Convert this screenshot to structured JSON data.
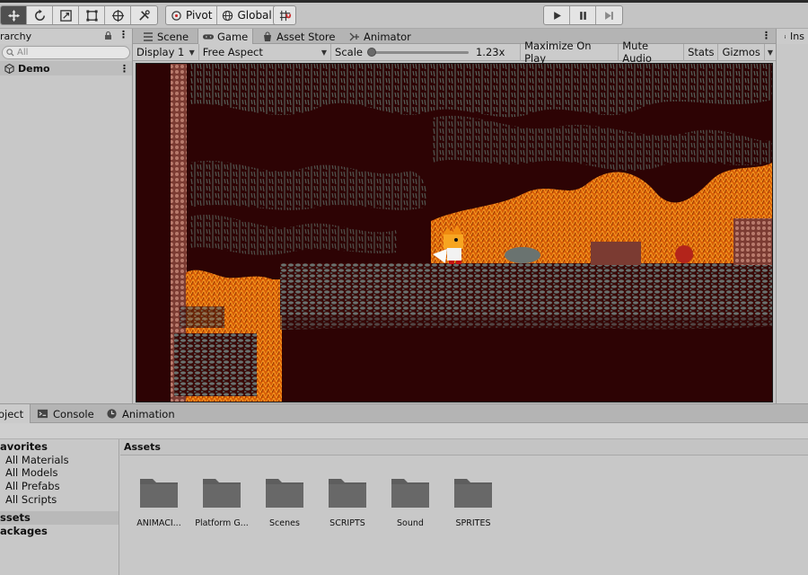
{
  "toolbar": {
    "pivot_label": "Pivot",
    "global_label": "Global"
  },
  "hierarchy": {
    "tab_label": "rarchy",
    "search_placeholder": "All",
    "scene_name": "Demo"
  },
  "game_view": {
    "tabs": [
      {
        "label": "Scene"
      },
      {
        "label": "Game"
      },
      {
        "label": "Asset Store"
      },
      {
        "label": "Animator"
      }
    ],
    "display": "Display 1",
    "aspect": "Free Aspect",
    "scale_label": "Scale",
    "scale_value": "1.23x",
    "maximize_on_play": "Maximize On Play",
    "mute_audio": "Mute Audio",
    "stats": "Stats",
    "gizmos": "Gizmos"
  },
  "inspector": {
    "tab_label": "Ins"
  },
  "project": {
    "tabs": [
      {
        "label": "oject"
      },
      {
        "label": "Console"
      },
      {
        "label": "Animation"
      }
    ],
    "favorites_label": "avorites",
    "favorites": [
      "All Materials",
      "All Models",
      "All Prefabs",
      "All Scripts"
    ],
    "assets_label": "ssets",
    "packages_label": "ackages",
    "assets_header": "Assets",
    "folders": [
      "ANIMACI...",
      "Platform G...",
      "Scenes",
      "SCRIPTS",
      "Sound",
      "SPRITES"
    ]
  },
  "colors": {
    "sky": "#2d0304",
    "ground_orange": "#d75e07",
    "rock_grey": "#6a7370"
  }
}
